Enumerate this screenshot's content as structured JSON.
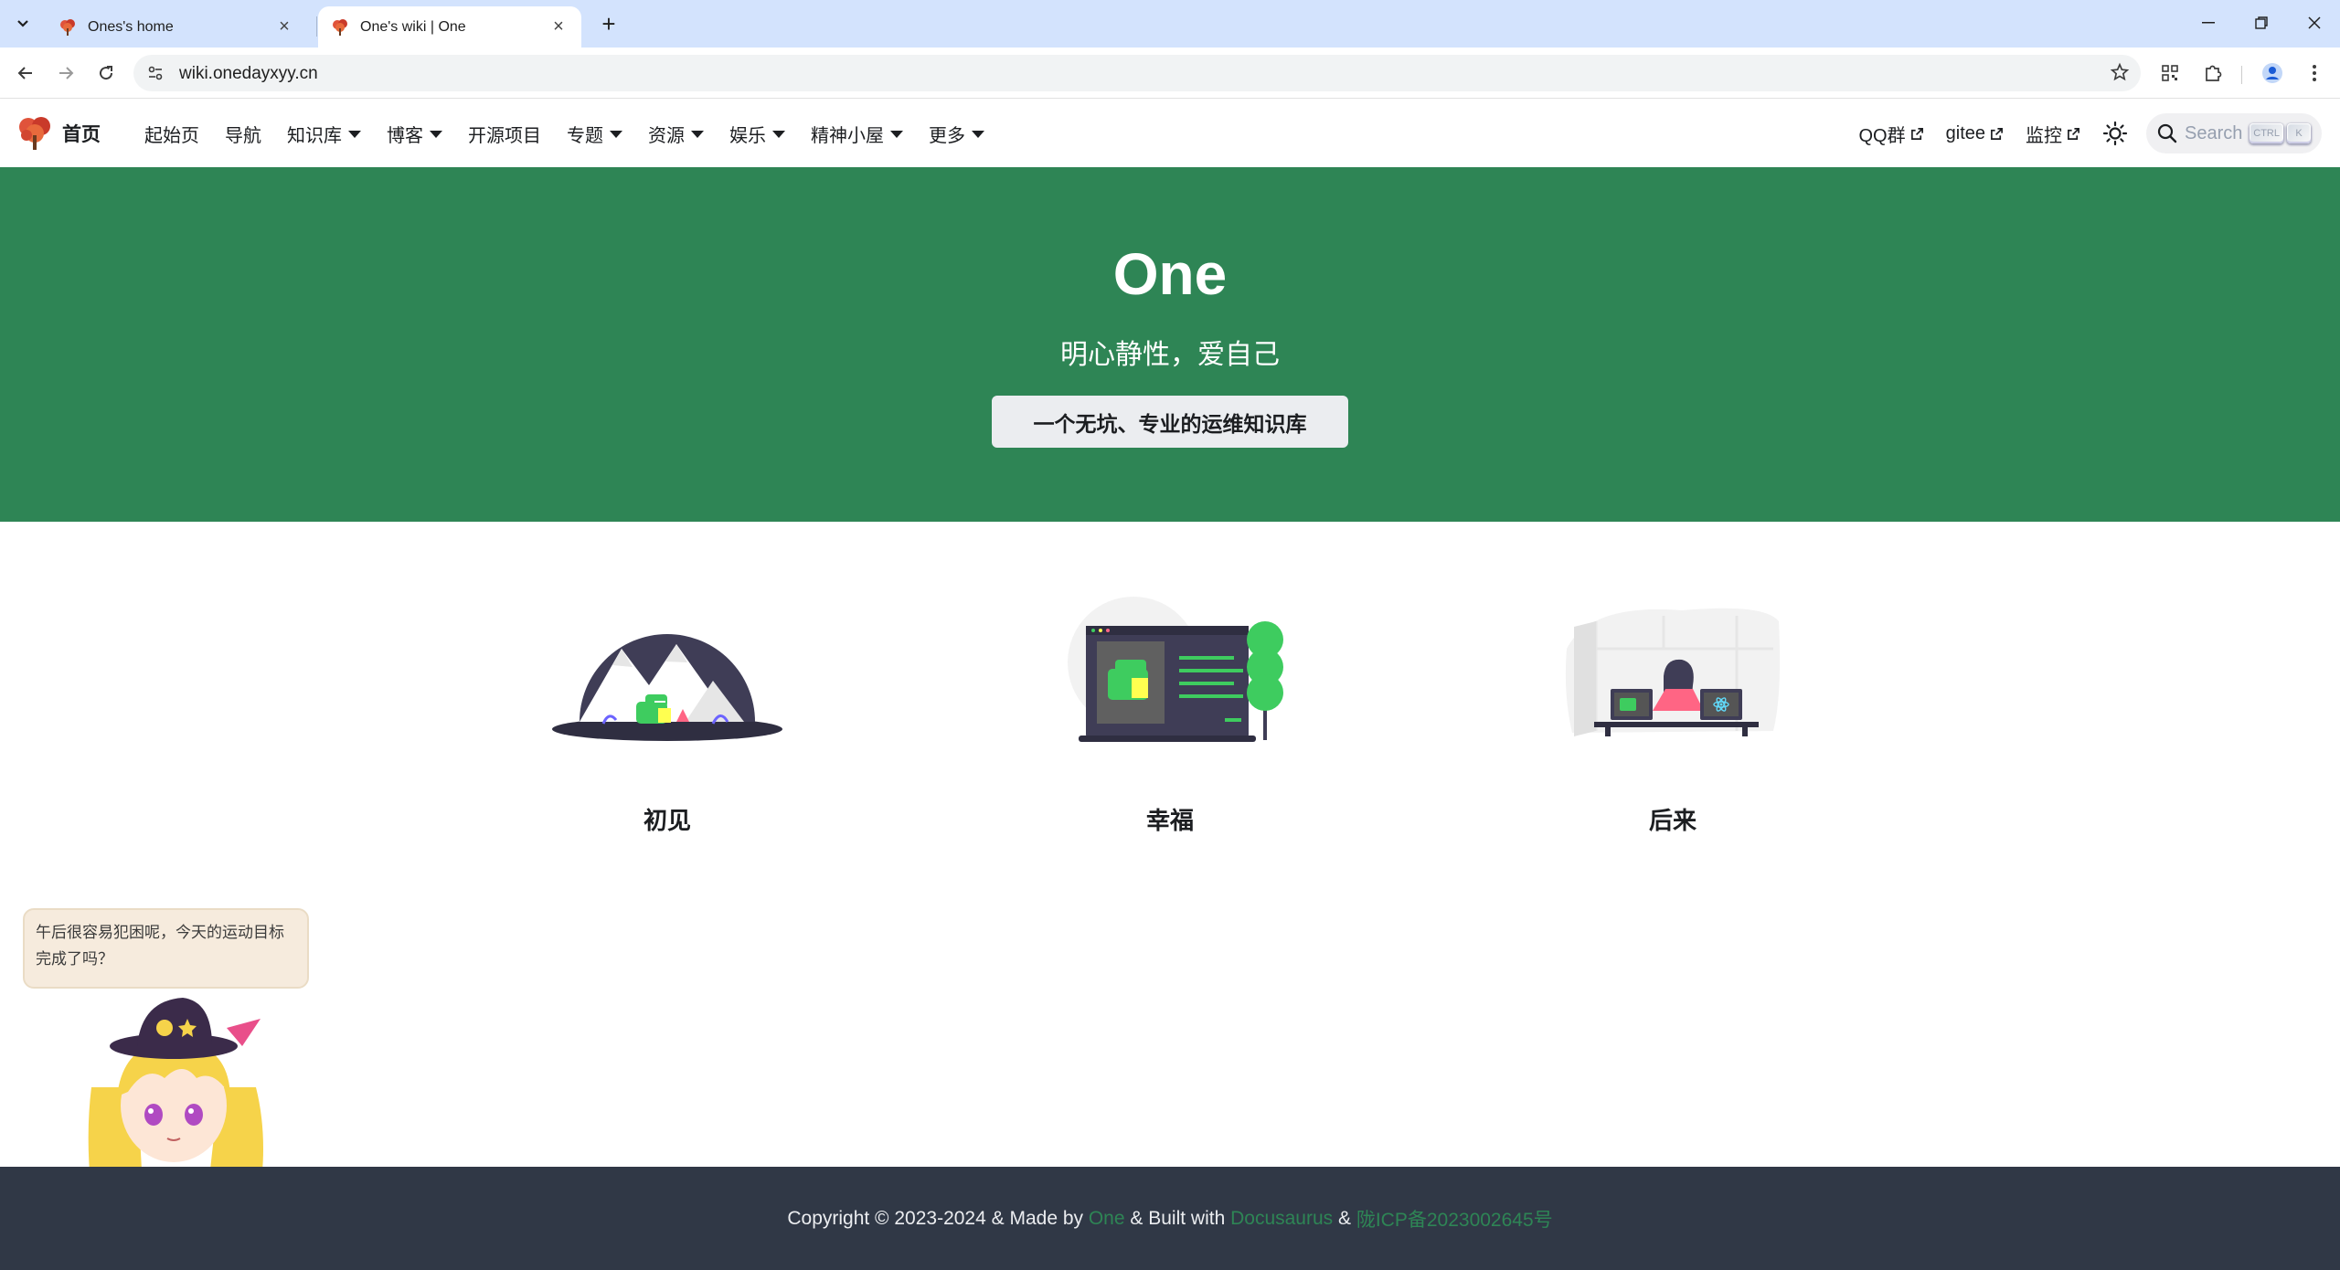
{
  "browser": {
    "tabs": [
      {
        "title": "Ones's home",
        "active": false
      },
      {
        "title": "One's wiki | One",
        "active": true
      }
    ],
    "url": "wiki.onedayxyy.cn"
  },
  "navbar": {
    "brand": "首页",
    "items": [
      {
        "label": "起始页",
        "dropdown": false
      },
      {
        "label": "导航",
        "dropdown": false
      },
      {
        "label": "知识库",
        "dropdown": true
      },
      {
        "label": "博客",
        "dropdown": true
      },
      {
        "label": "开源项目",
        "dropdown": false
      },
      {
        "label": "专题",
        "dropdown": true
      },
      {
        "label": "资源",
        "dropdown": true
      },
      {
        "label": "娱乐",
        "dropdown": true
      },
      {
        "label": "精神小屋",
        "dropdown": true
      },
      {
        "label": "更多",
        "dropdown": true
      }
    ],
    "external_links": [
      "QQ群",
      "gitee",
      "监控"
    ],
    "search": {
      "placeholder": "Search",
      "key1": "CTRL",
      "key2": "K"
    }
  },
  "hero": {
    "title": "One",
    "subtitle": "明心静性，爱自己",
    "button": "一个无坑、专业的运维知识库",
    "background": "#2e8555"
  },
  "features": [
    {
      "title": "初见"
    },
    {
      "title": "幸福"
    },
    {
      "title": "后来"
    }
  ],
  "mascot": {
    "message": "午后很容易犯困呢，今天的运动目标完成了吗？"
  },
  "footer": {
    "prefix": "Copyright © 2023-2024 & Made by ",
    "author": "One",
    "mid": " & Built with ",
    "framework": "Docusaurus",
    "sep": " & ",
    "icp": "陇ICP备2023002645号"
  },
  "colors": {
    "accent": "#2e8555",
    "footer_bg": "#303846",
    "tabbar_bg": "#d3e3fd"
  }
}
